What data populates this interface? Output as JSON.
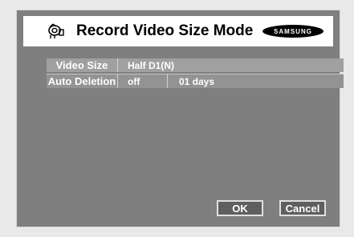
{
  "window": {
    "title": "Record Video Size Mode",
    "brand": "SAMSUNG",
    "icon": "camera-icon"
  },
  "settings": {
    "video_size": {
      "label": "Video Size",
      "value": "Half D1(N)"
    },
    "auto_deletion": {
      "label": "Auto Deletion",
      "mode": "off",
      "days": "01 days"
    }
  },
  "buttons": {
    "ok": "OK",
    "cancel": "Cancel"
  }
}
